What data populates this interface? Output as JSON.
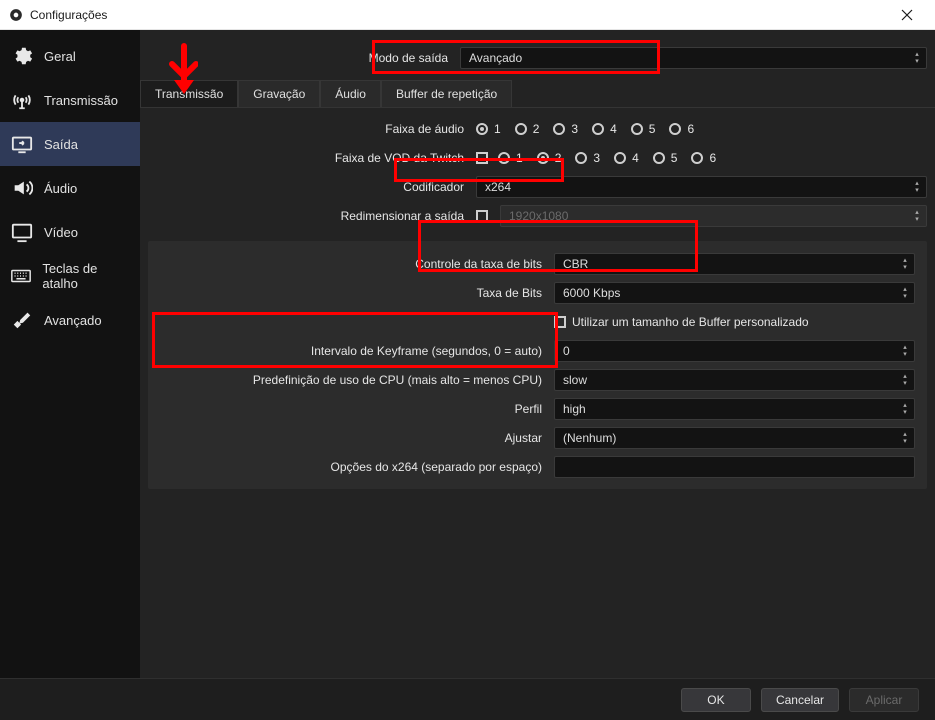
{
  "window": {
    "title": "Configurações"
  },
  "sidebar": {
    "items": [
      {
        "label": "Geral"
      },
      {
        "label": "Transmissão"
      },
      {
        "label": "Saída"
      },
      {
        "label": "Áudio"
      },
      {
        "label": "Vídeo"
      },
      {
        "label": "Teclas de atalho"
      },
      {
        "label": "Avançado"
      }
    ]
  },
  "mode": {
    "label": "Modo de saída",
    "value": "Avançado"
  },
  "tabs": [
    {
      "label": "Transmissão"
    },
    {
      "label": "Gravação"
    },
    {
      "label": "Áudio"
    },
    {
      "label": "Buffer de repetição"
    }
  ],
  "top": {
    "audio_track_label": "Faixa de áudio",
    "vod_track_label": "Faixa de VOD da Twitch",
    "tracks": [
      "1",
      "2",
      "3",
      "4",
      "5",
      "6"
    ],
    "audio_selected": 0,
    "vod_selected": 1,
    "encoder_label": "Codificador",
    "encoder_value": "x264",
    "rescale_label": "Redimensionar a saída",
    "rescale_value": "1920x1080"
  },
  "x264": {
    "rate_control_label": "Controle da taxa de bits",
    "rate_control_value": "CBR",
    "bitrate_label": "Taxa de Bits",
    "bitrate_value": "6000 Kbps",
    "custom_buffer_label": "Utilizar um tamanho de Buffer personalizado",
    "keyframe_label": "Intervalo de Keyframe (segundos, 0 = auto)",
    "keyframe_value": "0",
    "preset_label": "Predefinição de uso de CPU (mais alto = menos CPU)",
    "preset_value": "slow",
    "profile_label": "Perfil",
    "profile_value": "high",
    "tune_label": "Ajustar",
    "tune_value": "(Nenhum)",
    "x264opts_label": "Opções do x264 (separado por espaço)"
  },
  "footer": {
    "ok": "OK",
    "cancel": "Cancelar",
    "apply": "Aplicar"
  }
}
